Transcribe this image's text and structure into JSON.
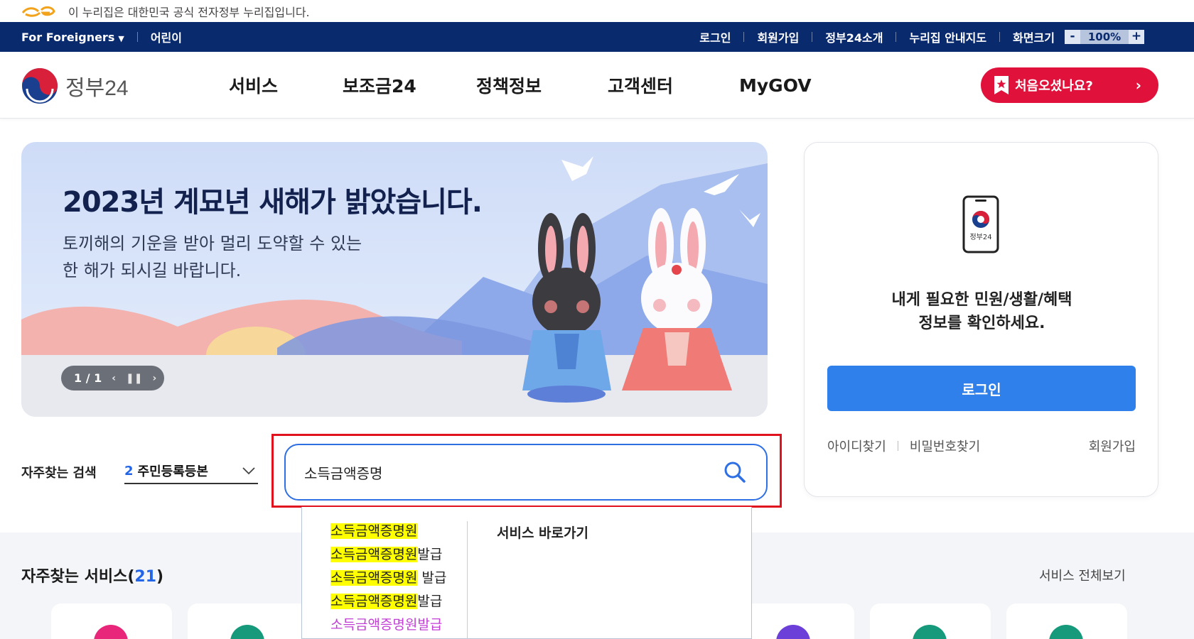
{
  "gov_banner": {
    "text": "이 누리집은 대한민국 공식 전자정부 누리집입니다."
  },
  "util_bar": {
    "foreigners": "For Foreigners",
    "kids": "어린이",
    "login": "로그인",
    "signup": "회원가입",
    "about": "정부24소개",
    "sitemap": "누리집 안내지도",
    "screen_size": "화면크기",
    "zoom_minus": "-",
    "zoom_value": "100%",
    "zoom_plus": "+"
  },
  "header": {
    "logo_text": "정부24",
    "nav": [
      "서비스",
      "보조금24",
      "정책정보",
      "고객센터",
      "MyGOV"
    ],
    "first_visit": "처음오셨나요?"
  },
  "hero": {
    "title": "2023년 계묘년 새해가 밝았습니다.",
    "sub_line1": "토끼해의 기운을 받아 멀리 도약할 수 있는",
    "sub_line2": "한 해가 되시길 바랍니다.",
    "slide_counter": "1 / 1"
  },
  "search": {
    "popular_label": "자주찾는 검색",
    "popular_rank": "2",
    "popular_term": "주민등록등본",
    "query": "소득금액증명"
  },
  "autocomplete": {
    "items": [
      {
        "match": "소득금액증명원",
        "rest": ""
      },
      {
        "match": "소득금액증명원",
        "rest": "발급"
      },
      {
        "match": "소득금액증명원",
        "rest": " 발급"
      },
      {
        "match": "소득금액증명원",
        "rest": "발급"
      },
      {
        "match": "소득금액증명원",
        "rest": "발급"
      }
    ],
    "side_title": "서비스 바로가기"
  },
  "frequent": {
    "title": "자주찾는 서비스(",
    "count": "21",
    "close": ")",
    "view_all": "서비스 전체보기"
  },
  "login_panel": {
    "icon_label": "정부24",
    "msg_line1": "내게 필요한 민원/생활/혜택",
    "msg_line2": "정보를 확인하세요.",
    "login_button": "로그인",
    "find_id": "아이디찾기",
    "find_pw": "비밀번호찾기",
    "signup": "회원가입"
  },
  "colors": {
    "navy": "#0a2a6e",
    "accent_blue": "#2f80ea",
    "brand_red": "#e0123c",
    "highlight_yellow": "#ffff00"
  }
}
